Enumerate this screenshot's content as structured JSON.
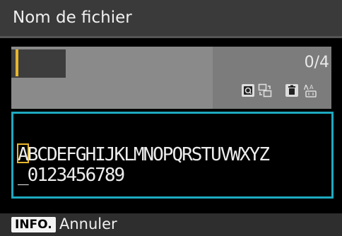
{
  "title": "Nom de fichier",
  "counter": "0/4",
  "keyboard": {
    "selected_char": "A",
    "row1_rest": "BCDEFGHIJKLMNOPQRSTUVWXYZ",
    "row2": "_0123456789"
  },
  "footer": {
    "info_label": "INFO.",
    "cancel_label": "Annuler"
  },
  "icons": [
    "q-button-icon",
    "switch-area-icon",
    "delete-icon",
    "case-toggle-icon"
  ],
  "colors": {
    "accent_yellow": "#e7b62c",
    "keyboard_border": "#1ea9c0"
  }
}
